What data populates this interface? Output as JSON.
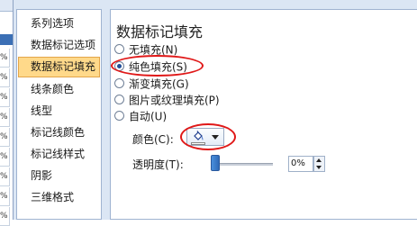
{
  "categories": [
    {
      "label": "系列选项",
      "selected": false
    },
    {
      "label": "数据标记选项",
      "selected": false
    },
    {
      "label": "数据标记填充",
      "selected": true
    },
    {
      "label": "线条颜色",
      "selected": false
    },
    {
      "label": "线型",
      "selected": false
    },
    {
      "label": "标记线颜色",
      "selected": false
    },
    {
      "label": "标记线样式",
      "selected": false
    },
    {
      "label": "阴影",
      "selected": false
    },
    {
      "label": "三维格式",
      "selected": false
    }
  ],
  "panel": {
    "title": "数据标记填充",
    "fill_options": [
      {
        "label": "无填充(N)",
        "checked": false
      },
      {
        "label": "纯色填充(S)",
        "checked": true
      },
      {
        "label": "渐变填充(G)",
        "checked": false
      },
      {
        "label": "图片或纹理填充(P)",
        "checked": false
      },
      {
        "label": "自动(U)",
        "checked": false
      }
    ],
    "color_label": "颜色(C):",
    "transparency_label": "透明度(T):",
    "transparency_value": "0%",
    "transparency_level": 0
  },
  "background": {
    "row_marks": [
      "%",
      "%",
      "%",
      "%",
      "%",
      "%",
      "%",
      "%",
      "%",
      "%"
    ]
  },
  "colors": {
    "annotation": "#e01818",
    "selected_item": "#ffd98a",
    "dialog_bg": "#dbe6f4"
  },
  "icons": [
    "paint-bucket-icon",
    "dropdown-arrow-icon",
    "spin-up-icon",
    "spin-down-icon"
  ]
}
